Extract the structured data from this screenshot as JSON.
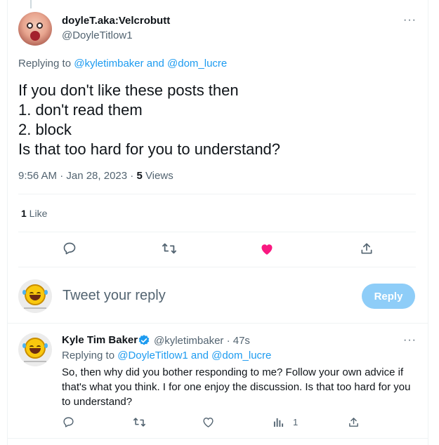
{
  "tweet": {
    "display_name": "doyleT.aka:Velcrobutt",
    "handle": "@DoyleTitlow1",
    "more_icon": "ellipsis-icon",
    "replying_prefix": "Replying to ",
    "replying_to": "@kyletimbaker and @dom_lucre",
    "text": "If you don't like these posts then\n1. don't read them\n2. block\nIs that too hard for you to understand?",
    "time_date": "9:56 AM · Jan 28, 2023 · ",
    "views_count": "5",
    "views_label": " Views",
    "likes_count": "1",
    "likes_label": " Like",
    "actions": {
      "reply_icon": "reply-icon",
      "retweet_icon": "retweet-icon",
      "like_icon": "heart-filled-icon",
      "share_icon": "share-icon"
    }
  },
  "composer": {
    "placeholder": "Tweet your reply",
    "button_label": "Reply"
  },
  "reply": {
    "display_name": "Kyle Tim Baker",
    "handle_time": "@kyletimbaker · 47s",
    "replying_prefix": "Replying to ",
    "replying_to": "@DoyleTitlow1 and @dom_lucre",
    "text": "So, then why did you bother responding to me? Follow your own advice if that's what you think. I for one enjoy the discussion. Is that too hard for you to understand?",
    "views_count": "1"
  },
  "colors": {
    "accent": "#1d9bf0",
    "like": "#f91880",
    "muted": "#536471",
    "button_disabled": "#8ecdf8"
  }
}
